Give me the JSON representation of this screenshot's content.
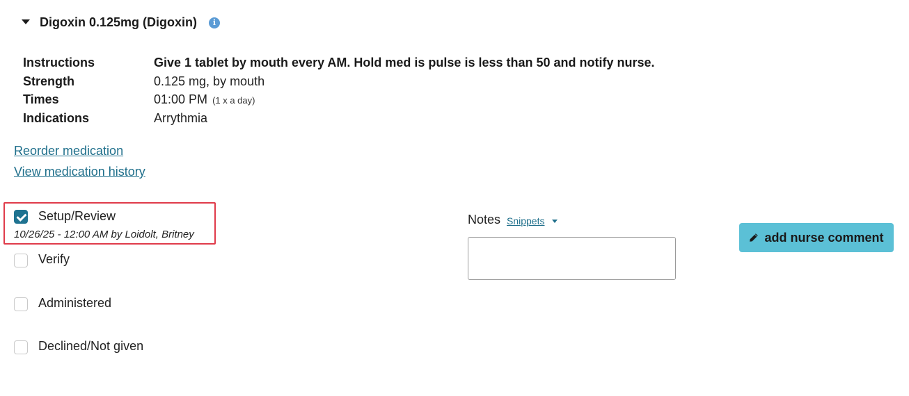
{
  "medication": {
    "title": "Digoxin 0.125mg (Digoxin)",
    "info_icon_glyph": "i"
  },
  "details": [
    {
      "label": "Instructions",
      "value": "Give 1 tablet by mouth every AM. Hold med is pulse is less than 50 and notify nurse."
    },
    {
      "label": "Strength",
      "value": "0.125 mg, by mouth"
    },
    {
      "label": "Times",
      "value": "01:00 PM",
      "note": "(1 x a day)"
    },
    {
      "label": "Indications",
      "value": "Arrythmia"
    }
  ],
  "links": {
    "reorder": "Reorder medication",
    "history": "View medication history"
  },
  "checklist": [
    {
      "label": "Setup/Review",
      "checked": true,
      "meta": "10/26/25 - 12:00 AM by Loidolt, Britney"
    },
    {
      "label": "Verify",
      "checked": false
    },
    {
      "label": "Administered",
      "checked": false
    },
    {
      "label": "Declined/Not given",
      "checked": false
    }
  ],
  "notes": {
    "label": "Notes",
    "snippets_label": "Snippets",
    "value": ""
  },
  "button": {
    "label": "add nurse comment",
    "icon": "pencil-icon",
    "color": "#5bc0d6"
  },
  "colors": {
    "link": "#1f6f8b",
    "checkbox_checked": "#1f7391",
    "highlight_border": "#e03b4a",
    "info_icon": "#5b9bd5"
  }
}
